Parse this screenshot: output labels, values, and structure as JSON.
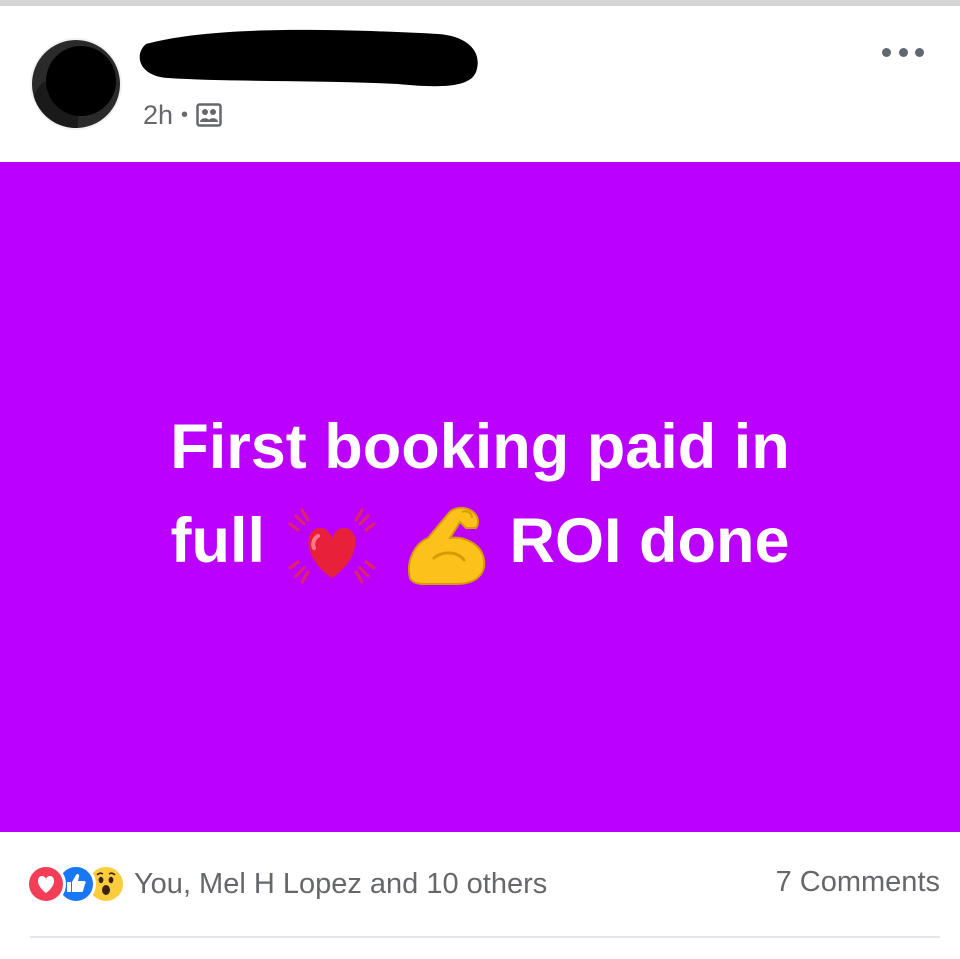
{
  "post": {
    "author": {
      "avatar": "profile-photo-obscured",
      "name_redacted": true
    },
    "time": "2h",
    "separator": "•",
    "audience_icon": "group-icon",
    "more_icon": "more-horizontal-icon",
    "text_line1": "First booking paid in",
    "text_line2_a": "full",
    "text_line2_b": "ROI done",
    "emojis": [
      "beating-heart-icon",
      "flexed-biceps-icon"
    ],
    "background_color": "#bb00ff",
    "text_color": "#ffffff"
  },
  "engagement": {
    "reaction_icons": [
      "love-reaction-icon",
      "like-reaction-icon",
      "wow-reaction-icon"
    ],
    "reactions_text": "You, Mel H Lopez and 10 others",
    "comments_text": "7 Comments"
  }
}
